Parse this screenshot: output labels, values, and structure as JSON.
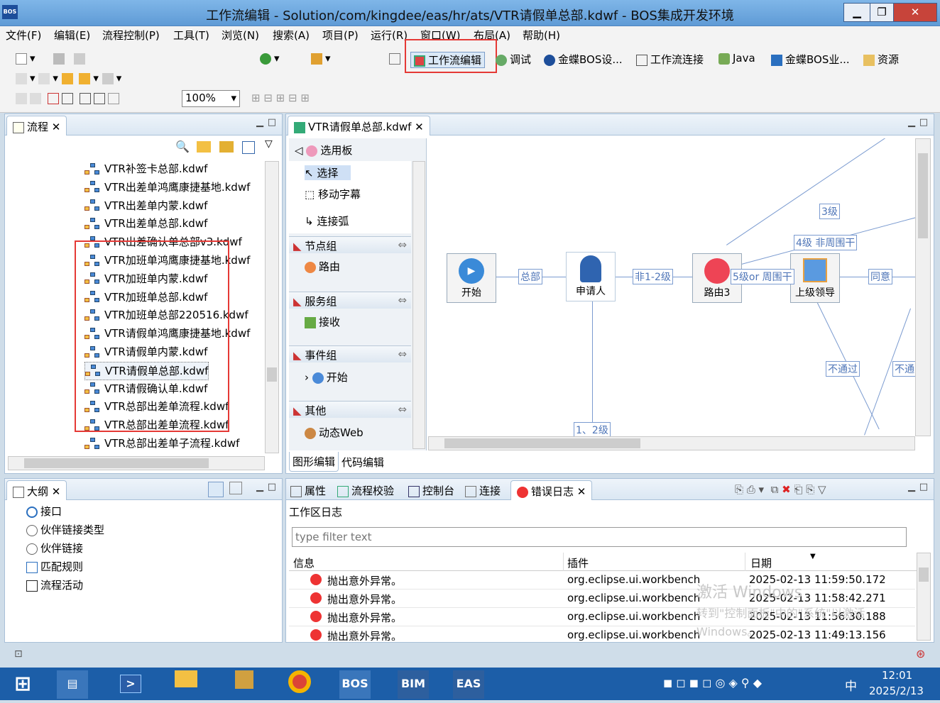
{
  "window": {
    "title": "工作流编辑  -  Solution/com/kingdee/eas/hr/ats/VTR请假单总部.kdwf  -  BOS集成开发环境",
    "app_icon": "BOS",
    "buttons": {
      "minimize": "▁",
      "restore": "❐",
      "close": "✕"
    }
  },
  "menu": [
    "文件(F)",
    "编辑(E)",
    "流程控制(P)",
    "工具(T)",
    "浏览(N)",
    "搜索(A)",
    "项目(P)",
    "运行(R)",
    "窗口(W)",
    "布局(A)",
    "帮助(H)"
  ],
  "toolbar": {
    "zoom": "100%",
    "perspectives": [
      {
        "label": "工作流编辑",
        "active": true
      },
      {
        "label": "调试"
      },
      {
        "label": "金蝶BOS设..."
      },
      {
        "label": "工作流连接"
      },
      {
        "label": "Java"
      },
      {
        "label": "金蝶BOS业..."
      },
      {
        "label": "资源"
      }
    ]
  },
  "flow_panel": {
    "tab": "流程",
    "items": [
      "VTR补签卡总部.kdwf",
      "VTR出差单鸿鹰康捷基地.kdwf",
      "VTR出差单内蒙.kdwf",
      "VTR出差单总部.kdwf",
      "VTR出差确认单总部v3.kdwf",
      "VTR加班单鸿鹰康捷基地.kdwf",
      "VTR加班单内蒙.kdwf",
      "VTR加班单总部.kdwf",
      "VTR加班单总部220516.kdwf",
      "VTR请假单鸿鹰康捷基地.kdwf",
      "VTR请假单内蒙.kdwf",
      "VTR请假单总部.kdwf",
      "VTR请假确认单.kdwf",
      "VTR总部出差单流程.kdwf",
      "VTR总部出差单流程.kdwf",
      "VTR总部出差单子流程.kdwf"
    ],
    "selected_index": 11
  },
  "editor": {
    "tab": "VTR请假单总部.kdwf",
    "palette": {
      "title": "选用板",
      "tools": [
        "选择",
        "移动字幕",
        "连接弧"
      ],
      "groups": [
        {
          "name": "节点组",
          "item": "路由"
        },
        {
          "name": "服务组",
          "item": "接收"
        },
        {
          "name": "事件组",
          "item": "开始"
        },
        {
          "name": "其他",
          "item": "动态Web"
        }
      ]
    },
    "nodes": [
      "开始",
      "申请人",
      "路由3",
      "上级领导"
    ],
    "edge_labels": [
      "总部",
      "非1-2级",
      "5级or 周围干",
      "3级",
      "4级 非周围干",
      "同意",
      "不通过",
      "不通",
      "1、2级"
    ],
    "bottom_tabs": [
      "图形编辑",
      "代码编辑"
    ]
  },
  "outline": {
    "tab": "大纲",
    "items": [
      "接口",
      "伙伴链接类型",
      "伙伴链接",
      "匹配规则",
      "流程活动"
    ]
  },
  "log_panel": {
    "tabs": [
      "属性",
      "流程校验",
      "控制台",
      "连接",
      "错误日志"
    ],
    "active_tab": "错误日志",
    "title": "工作区日志",
    "filter_placeholder": "type filter text",
    "columns": [
      "信息",
      "插件",
      "日期"
    ],
    "rows": [
      {
        "msg": "抛出意外异常。",
        "plugin": "org.eclipse.ui.workbench",
        "date": "2025-02-13 11:59:50.172"
      },
      {
        "msg": "抛出意外异常。",
        "plugin": "org.eclipse.ui.workbench",
        "date": "2025-02-13 11:58:42.271"
      },
      {
        "msg": "抛出意外异常。",
        "plugin": "org.eclipse.ui.workbench",
        "date": "2025-02-13 11:56:30.188"
      },
      {
        "msg": "抛出意外异常。",
        "plugin": "org.eclipse.ui.workbench",
        "date": "2025-02-13 11:49:13.156"
      }
    ],
    "watermark": [
      "激活 Windows",
      "转到\"控制面板\"中的\"系统\"以激活",
      "Windows。"
    ]
  },
  "taskbar": {
    "apps": [
      "BOS",
      "BIM",
      "EAS"
    ],
    "ime": "中",
    "time": "12:01",
    "date": "2025/2/13"
  },
  "colors": {
    "title_bg": "#6fa8e0",
    "accent": "#2a6fbf",
    "highlight": "#e53935",
    "taskbar": "#1c5ea8"
  }
}
